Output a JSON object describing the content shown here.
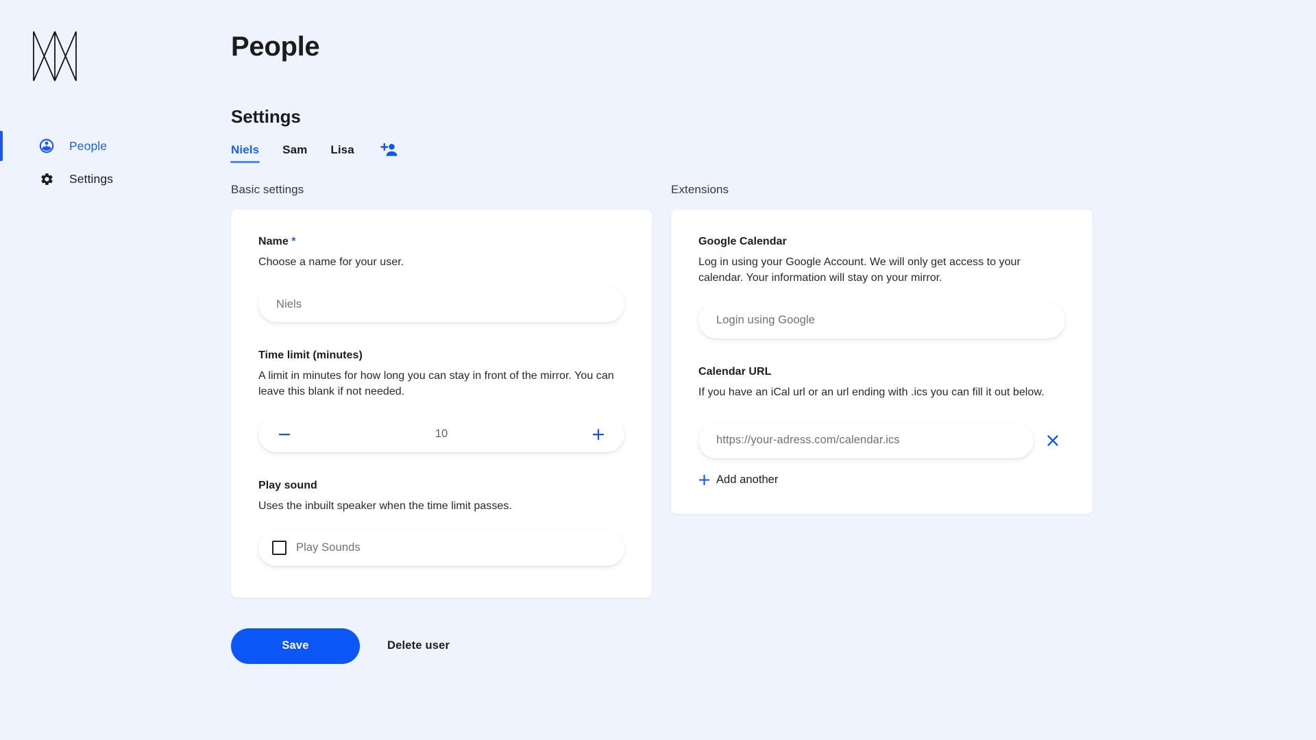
{
  "colors": {
    "background": "#eef3fd",
    "accent": "#1a62f2",
    "primary_button": "#0b57f5",
    "card": "#ffffff",
    "text": "#1b1c1e",
    "muted_text": "#6e7278"
  },
  "sidebar": {
    "logo_name": "magicmirror-logo",
    "items": [
      {
        "label": "People",
        "icon": "person-circle-icon",
        "active": true
      },
      {
        "label": "Settings",
        "icon": "gear-icon",
        "active": false
      }
    ]
  },
  "header": {
    "title": "People"
  },
  "settings": {
    "section_title": "Settings",
    "tabs": [
      {
        "label": "Niels",
        "active": true
      },
      {
        "label": "Sam",
        "active": false
      },
      {
        "label": "Lisa",
        "active": false
      }
    ],
    "add_user_icon": "person-add-icon"
  },
  "basic": {
    "column_label": "Basic settings",
    "name": {
      "label": "Name",
      "required_marker": "*",
      "description": "Choose a name for your user.",
      "value": "Niels",
      "placeholder": "Niels"
    },
    "time_limit": {
      "label": "Time limit (minutes)",
      "description": "A limit in minutes for how long you can stay in front of the mirror. You can leave this blank if not needed.",
      "value": "10",
      "decrement_icon": "minus-icon",
      "increment_icon": "plus-icon"
    },
    "play_sound": {
      "label": "Play sound",
      "description": "Uses the inbuilt speaker when the time limit passes.",
      "checkbox_label": "Play Sounds",
      "checked": false
    }
  },
  "extensions": {
    "column_label": "Extensions",
    "google_calendar": {
      "label": "Google Calendar",
      "description": "Log in using your Google Account. We will only get access to your calendar. Your information will stay on your mirror.",
      "button_label": "Login using Google"
    },
    "calendar_url": {
      "label": "Calendar URL",
      "description": "If you have an iCal url or an url ending with .ics you can fill it out below.",
      "value": "",
      "placeholder": "https://your-adress.com/calendar.ics",
      "remove_icon": "close-icon",
      "add_another_label": "Add another",
      "add_another_icon": "plus-icon"
    }
  },
  "footer": {
    "save_label": "Save",
    "delete_label": "Delete user"
  }
}
